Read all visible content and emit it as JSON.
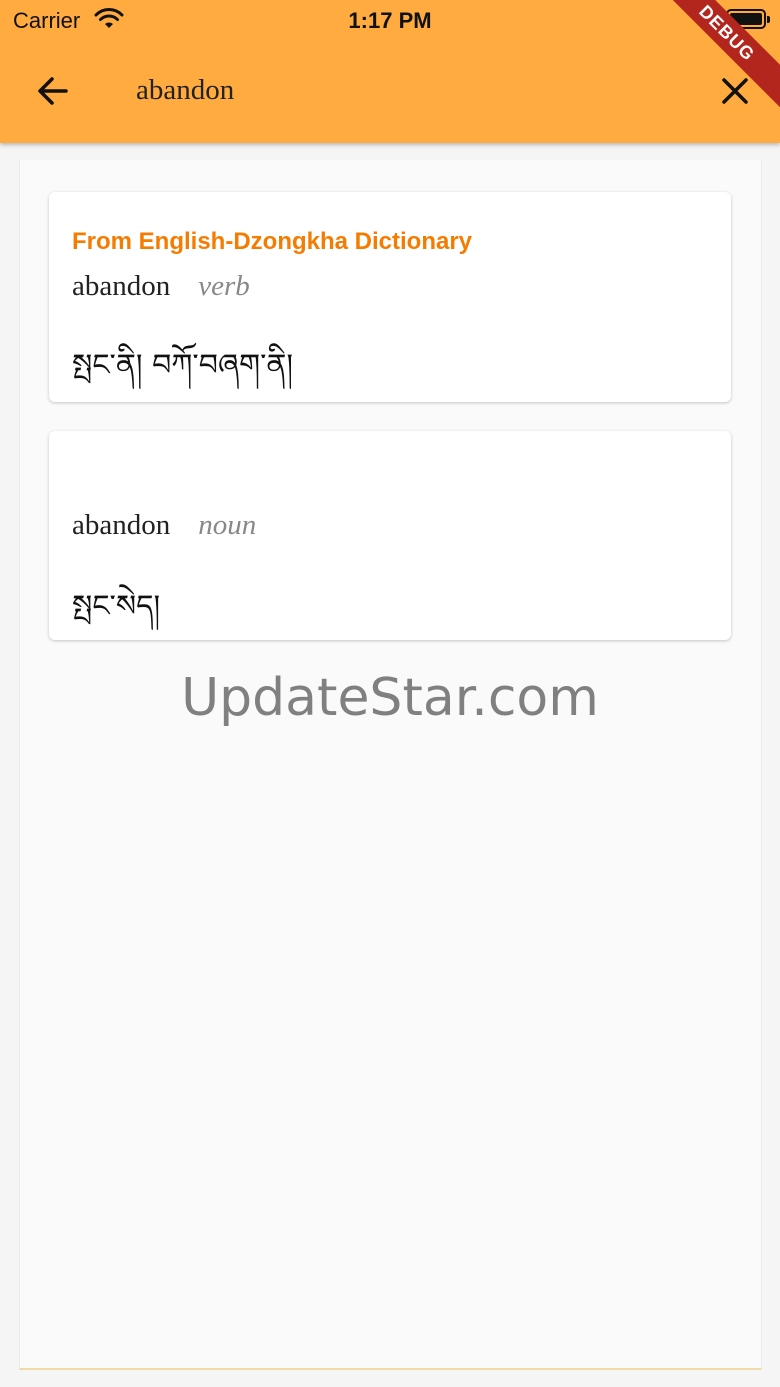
{
  "status_bar": {
    "carrier": "Carrier",
    "time": "1:17 PM"
  },
  "app_bar": {
    "search_query": "abandon",
    "debug_label": "DEBUG"
  },
  "results": [
    {
      "source": "From English-Dzongkha Dictionary",
      "word": "abandon",
      "pos": "verb",
      "translation": "སྤང་ནི། བཀོ་བཞག་ནི།"
    },
    {
      "source": "",
      "word": "abandon",
      "pos": "noun",
      "translation": "སྤང་སེད།"
    }
  ],
  "watermark": "UpdateStar.com",
  "colors": {
    "app_bar": "#ffab40",
    "source_accent": "#f57c00",
    "debug_ribbon": "#b3261e"
  },
  "icons": {
    "back": "arrow-left-icon",
    "clear": "close-icon",
    "wifi": "wifi-icon",
    "battery": "battery-icon"
  }
}
